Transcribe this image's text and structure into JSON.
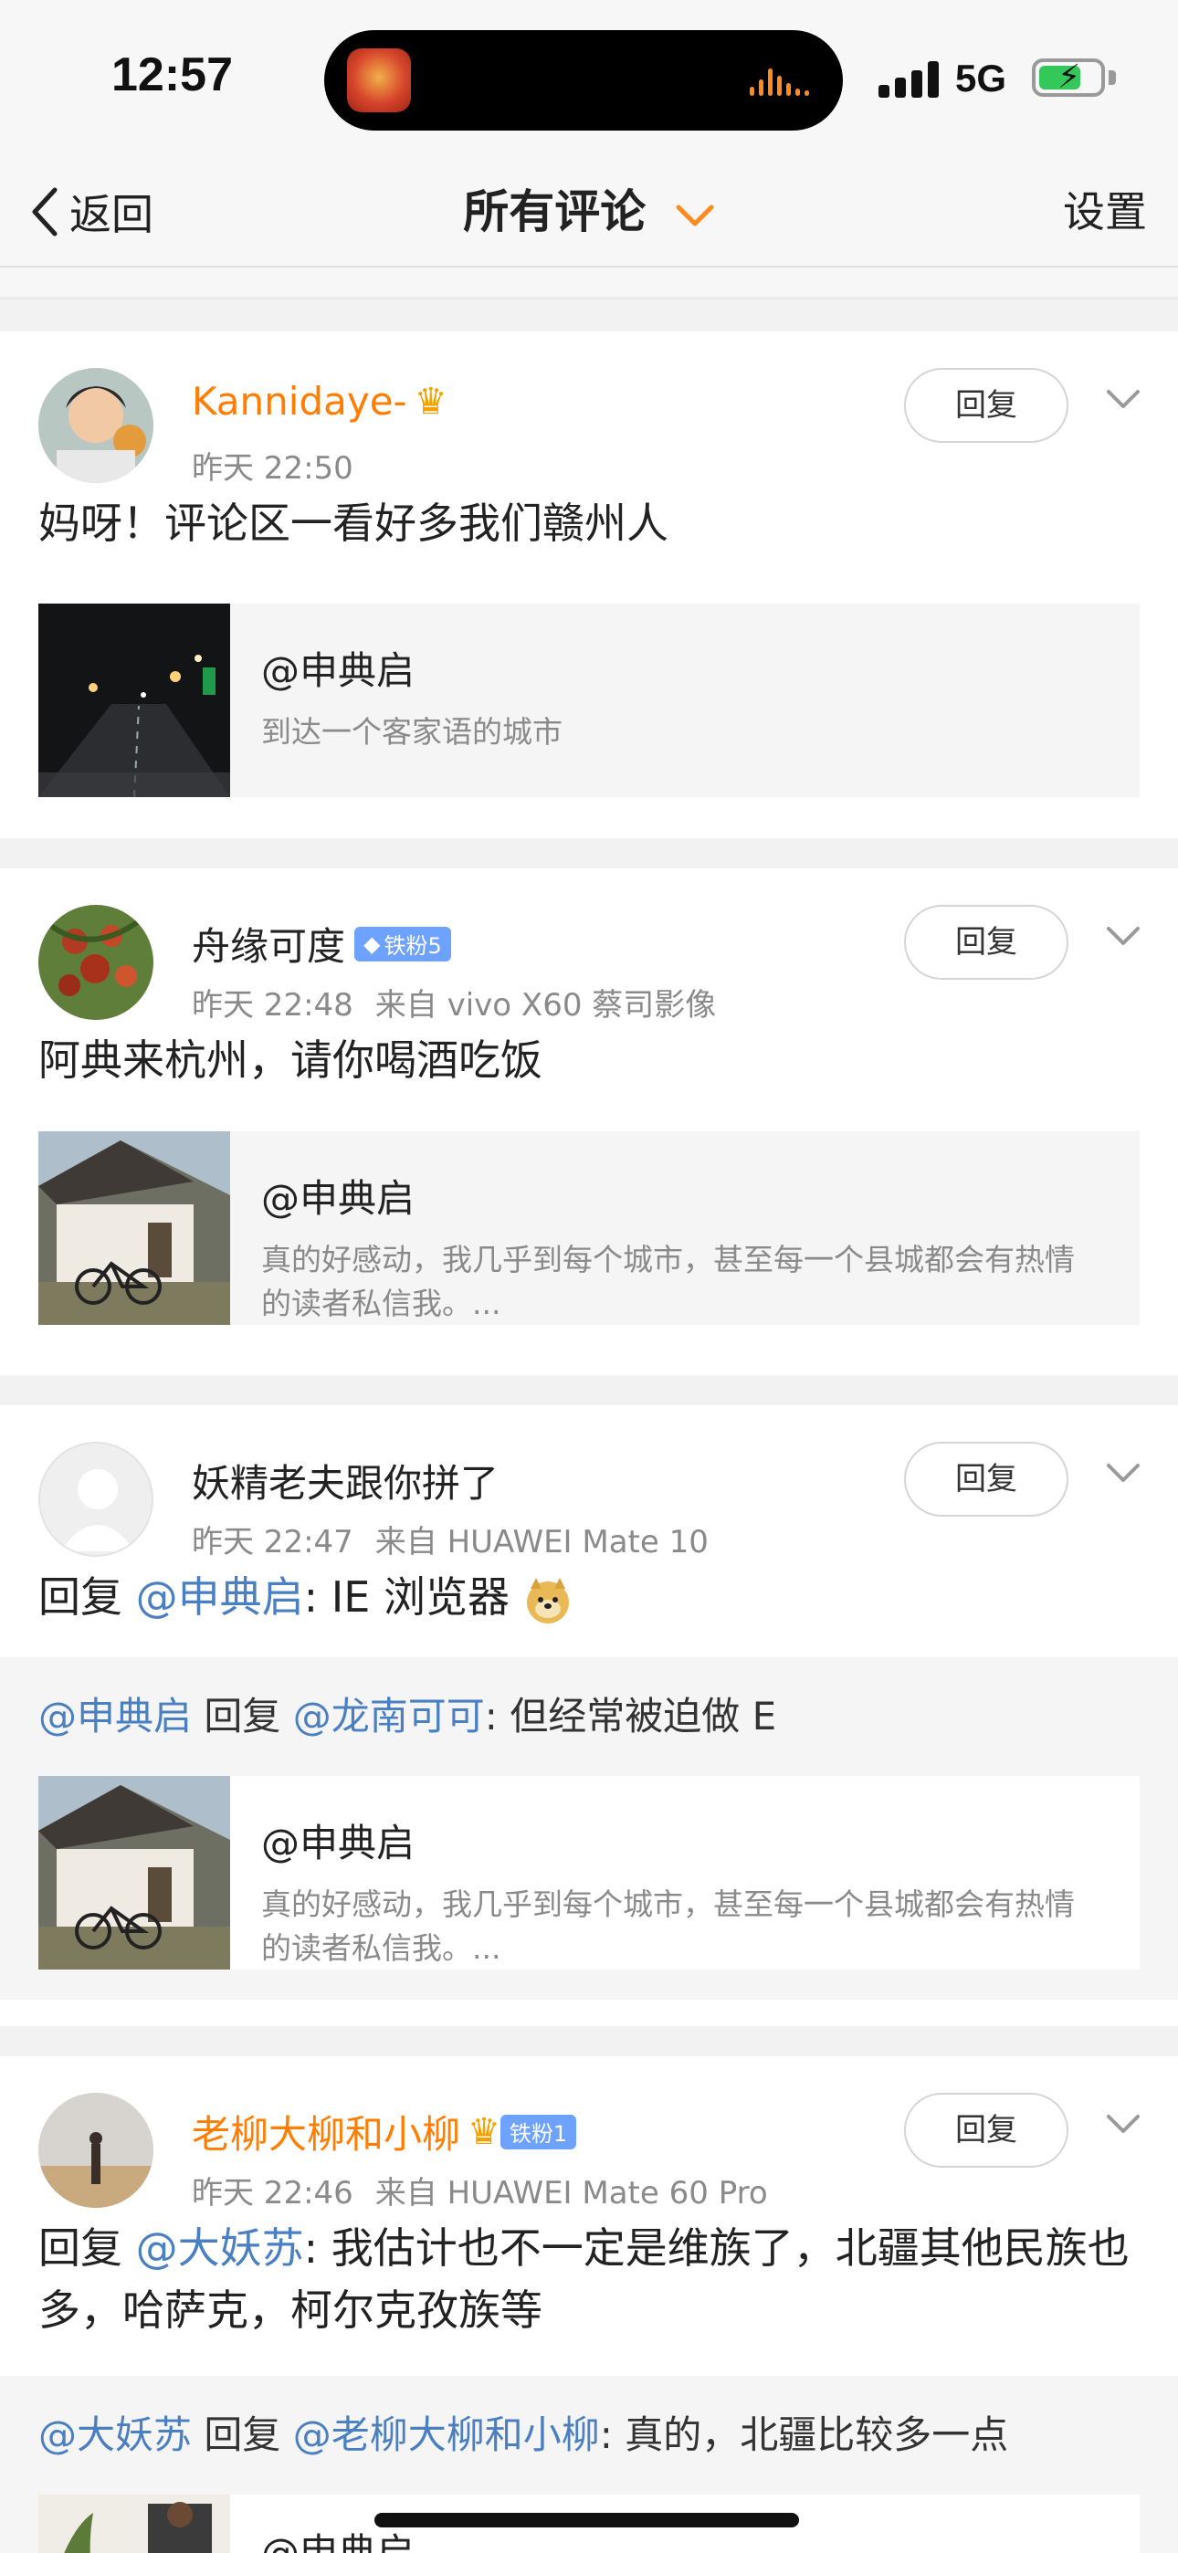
{
  "status_bar": {
    "time": "12:57",
    "network": "5G",
    "battery_level": 0.7,
    "icons": [
      "app-icon",
      "audio-wave-icon",
      "signal-icon",
      "battery-charging-icon"
    ]
  },
  "nav": {
    "back_label": "返回",
    "title": "所有评论",
    "settings_label": "设置",
    "accent_color": "#ff8a1e"
  },
  "comments": [
    {
      "username": "Kannidaye-",
      "vip": true,
      "time": "昨天 22:50",
      "source": "",
      "fan_badge": "",
      "text": "妈呀！评论区一看好多我们赣州人",
      "reply_label": "回复",
      "quote": {
        "name": "@申典启",
        "desc": "到达一个客家语的城市"
      }
    },
    {
      "username": "舟缘可度",
      "vip": false,
      "time": "昨天 22:48",
      "source": "来自 vivo X60 蔡司影像",
      "fan_badge": "铁粉5",
      "text": "阿典来杭州，请你喝酒吃饭",
      "reply_label": "回复",
      "quote": {
        "name": "@申典启",
        "desc": "真的好感动，我几乎到每个城市，甚至每一个县城都会有热情的读者私信我。..."
      }
    },
    {
      "username": "妖精老夫跟你拼了",
      "vip": false,
      "time": "昨天 22:47",
      "source": "来自 HUAWEI Mate 10",
      "fan_badge": "",
      "text_prefix": "回复 ",
      "text_mention": "@申典启",
      "text_suffix": ": IE 浏览器",
      "reply_label": "回复",
      "subreply": {
        "author": "@申典启",
        "verb": " 回复 ",
        "target": "@龙南可可",
        "text": ": 但经常被迫做 E"
      },
      "quote": {
        "name": "@申典启",
        "desc": "真的好感动，我几乎到每个城市，甚至每一个县城都会有热情的读者私信我。..."
      }
    },
    {
      "username": "老柳大柳和小柳",
      "vip": true,
      "time": "昨天 22:46",
      "source": "来自 HUAWEI Mate 60 Pro",
      "fan_badge": "铁粉1",
      "text_prefix": "回复 ",
      "text_mention": "@大妖苏",
      "text_suffix": ": 我估计也不一定是维族了，北疆其他民族也多，哈萨克，柯尔克孜族等",
      "reply_label": "回复",
      "subreply": {
        "author": "@大妖苏",
        "verb": " 回复 ",
        "target": "@老柳大柳和小柳",
        "text": ": 真的，北疆比较多一点"
      },
      "quote": {
        "name": "@申典启",
        "desc": ""
      }
    }
  ]
}
